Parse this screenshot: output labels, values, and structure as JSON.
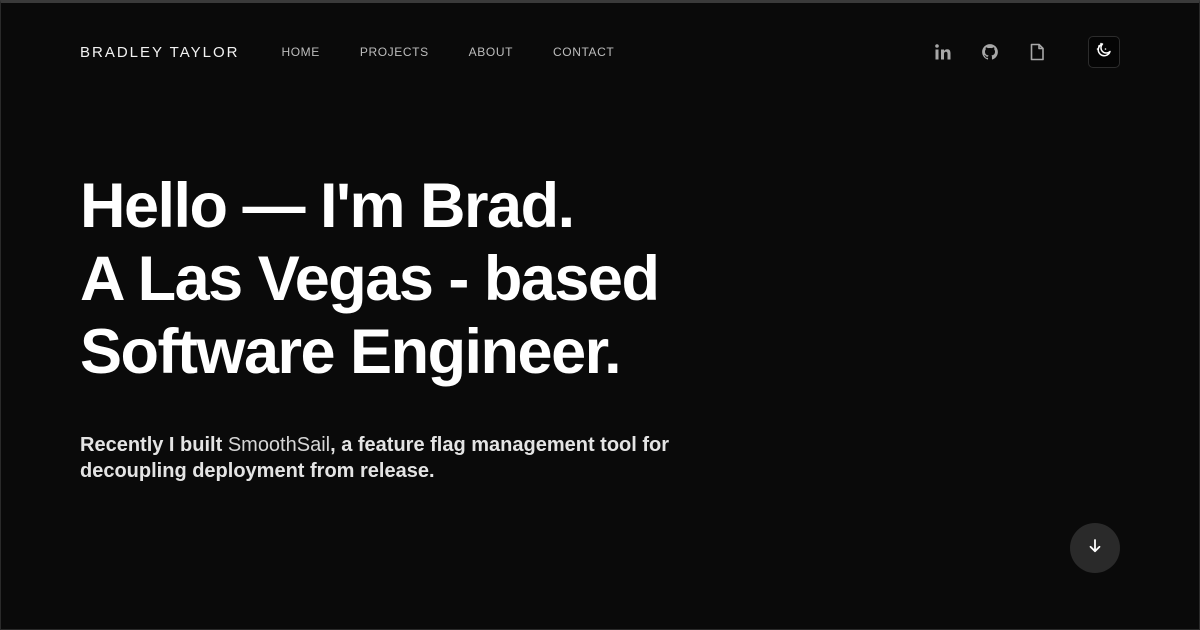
{
  "header": {
    "brand": "BRADLEY TAYLOR",
    "nav": [
      {
        "label": "HOME"
      },
      {
        "label": "PROJECTS"
      },
      {
        "label": "ABOUT"
      },
      {
        "label": "CONTACT"
      }
    ],
    "social_icons": [
      "linkedin-icon",
      "github-icon",
      "resume-document-icon"
    ],
    "theme_toggle_icon": "moon-sun-icon"
  },
  "hero": {
    "title_lines": [
      "Hello — I'm Brad.",
      "A Las Vegas - based",
      "Software Engineer."
    ],
    "intro_before": "Recently I built ",
    "intro_link": "SmoothSail",
    "intro_after": ", a feature flag management tool for decoupling deployment from release."
  },
  "scroll_button_icon": "arrow-down-icon",
  "colors": {
    "background": "#0a0a0a",
    "text": "#ffffff",
    "nav_text": "#bdbdbd",
    "icon": "#a8a8a8",
    "scroll_button_bg": "#2a2a2a"
  }
}
